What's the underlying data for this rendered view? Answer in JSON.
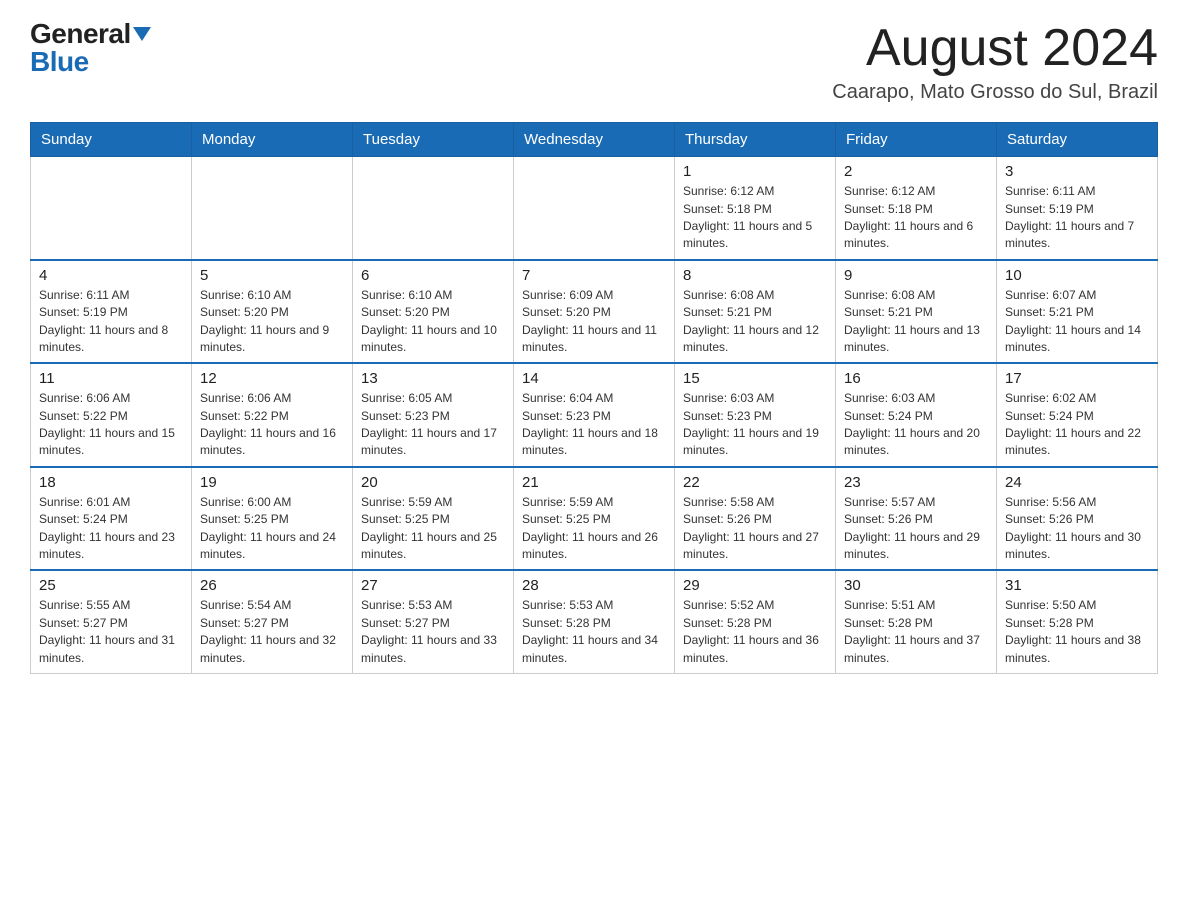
{
  "header": {
    "logo_general": "General",
    "logo_blue": "Blue",
    "month_title": "August 2024",
    "location": "Caarapo, Mato Grosso do Sul, Brazil"
  },
  "days_of_week": [
    "Sunday",
    "Monday",
    "Tuesday",
    "Wednesday",
    "Thursday",
    "Friday",
    "Saturday"
  ],
  "weeks": [
    {
      "days": [
        {
          "num": "",
          "info": ""
        },
        {
          "num": "",
          "info": ""
        },
        {
          "num": "",
          "info": ""
        },
        {
          "num": "",
          "info": ""
        },
        {
          "num": "1",
          "info": "Sunrise: 6:12 AM\nSunset: 5:18 PM\nDaylight: 11 hours and 5 minutes."
        },
        {
          "num": "2",
          "info": "Sunrise: 6:12 AM\nSunset: 5:18 PM\nDaylight: 11 hours and 6 minutes."
        },
        {
          "num": "3",
          "info": "Sunrise: 6:11 AM\nSunset: 5:19 PM\nDaylight: 11 hours and 7 minutes."
        }
      ]
    },
    {
      "days": [
        {
          "num": "4",
          "info": "Sunrise: 6:11 AM\nSunset: 5:19 PM\nDaylight: 11 hours and 8 minutes."
        },
        {
          "num": "5",
          "info": "Sunrise: 6:10 AM\nSunset: 5:20 PM\nDaylight: 11 hours and 9 minutes."
        },
        {
          "num": "6",
          "info": "Sunrise: 6:10 AM\nSunset: 5:20 PM\nDaylight: 11 hours and 10 minutes."
        },
        {
          "num": "7",
          "info": "Sunrise: 6:09 AM\nSunset: 5:20 PM\nDaylight: 11 hours and 11 minutes."
        },
        {
          "num": "8",
          "info": "Sunrise: 6:08 AM\nSunset: 5:21 PM\nDaylight: 11 hours and 12 minutes."
        },
        {
          "num": "9",
          "info": "Sunrise: 6:08 AM\nSunset: 5:21 PM\nDaylight: 11 hours and 13 minutes."
        },
        {
          "num": "10",
          "info": "Sunrise: 6:07 AM\nSunset: 5:21 PM\nDaylight: 11 hours and 14 minutes."
        }
      ]
    },
    {
      "days": [
        {
          "num": "11",
          "info": "Sunrise: 6:06 AM\nSunset: 5:22 PM\nDaylight: 11 hours and 15 minutes."
        },
        {
          "num": "12",
          "info": "Sunrise: 6:06 AM\nSunset: 5:22 PM\nDaylight: 11 hours and 16 minutes."
        },
        {
          "num": "13",
          "info": "Sunrise: 6:05 AM\nSunset: 5:23 PM\nDaylight: 11 hours and 17 minutes."
        },
        {
          "num": "14",
          "info": "Sunrise: 6:04 AM\nSunset: 5:23 PM\nDaylight: 11 hours and 18 minutes."
        },
        {
          "num": "15",
          "info": "Sunrise: 6:03 AM\nSunset: 5:23 PM\nDaylight: 11 hours and 19 minutes."
        },
        {
          "num": "16",
          "info": "Sunrise: 6:03 AM\nSunset: 5:24 PM\nDaylight: 11 hours and 20 minutes."
        },
        {
          "num": "17",
          "info": "Sunrise: 6:02 AM\nSunset: 5:24 PM\nDaylight: 11 hours and 22 minutes."
        }
      ]
    },
    {
      "days": [
        {
          "num": "18",
          "info": "Sunrise: 6:01 AM\nSunset: 5:24 PM\nDaylight: 11 hours and 23 minutes."
        },
        {
          "num": "19",
          "info": "Sunrise: 6:00 AM\nSunset: 5:25 PM\nDaylight: 11 hours and 24 minutes."
        },
        {
          "num": "20",
          "info": "Sunrise: 5:59 AM\nSunset: 5:25 PM\nDaylight: 11 hours and 25 minutes."
        },
        {
          "num": "21",
          "info": "Sunrise: 5:59 AM\nSunset: 5:25 PM\nDaylight: 11 hours and 26 minutes."
        },
        {
          "num": "22",
          "info": "Sunrise: 5:58 AM\nSunset: 5:26 PM\nDaylight: 11 hours and 27 minutes."
        },
        {
          "num": "23",
          "info": "Sunrise: 5:57 AM\nSunset: 5:26 PM\nDaylight: 11 hours and 29 minutes."
        },
        {
          "num": "24",
          "info": "Sunrise: 5:56 AM\nSunset: 5:26 PM\nDaylight: 11 hours and 30 minutes."
        }
      ]
    },
    {
      "days": [
        {
          "num": "25",
          "info": "Sunrise: 5:55 AM\nSunset: 5:27 PM\nDaylight: 11 hours and 31 minutes."
        },
        {
          "num": "26",
          "info": "Sunrise: 5:54 AM\nSunset: 5:27 PM\nDaylight: 11 hours and 32 minutes."
        },
        {
          "num": "27",
          "info": "Sunrise: 5:53 AM\nSunset: 5:27 PM\nDaylight: 11 hours and 33 minutes."
        },
        {
          "num": "28",
          "info": "Sunrise: 5:53 AM\nSunset: 5:28 PM\nDaylight: 11 hours and 34 minutes."
        },
        {
          "num": "29",
          "info": "Sunrise: 5:52 AM\nSunset: 5:28 PM\nDaylight: 11 hours and 36 minutes."
        },
        {
          "num": "30",
          "info": "Sunrise: 5:51 AM\nSunset: 5:28 PM\nDaylight: 11 hours and 37 minutes."
        },
        {
          "num": "31",
          "info": "Sunrise: 5:50 AM\nSunset: 5:28 PM\nDaylight: 11 hours and 38 minutes."
        }
      ]
    }
  ]
}
